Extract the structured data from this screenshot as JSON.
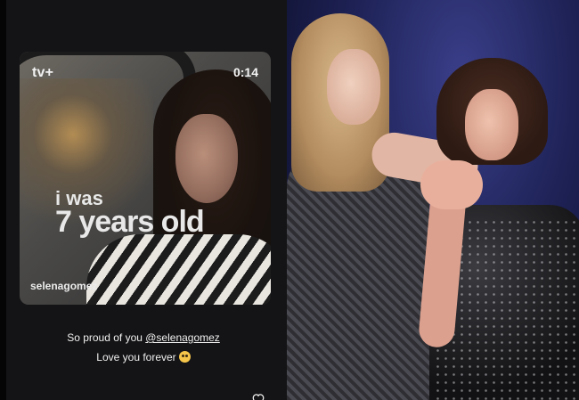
{
  "story": {
    "video": {
      "brand_label": "tv+",
      "time": "0:14",
      "caption_line1": "i was",
      "caption_line2": "7 years old",
      "watermark": "selenagomez"
    },
    "text_prefix": "So proud of you ",
    "mention": "@selenagomez",
    "text_line2": "Love you forever"
  },
  "icons": {
    "apple_logo": "apple-logo-icon",
    "emoji": "pleading-face-emoji-icon",
    "like": "heart-icon"
  },
  "colors": {
    "story_bg": "#141416",
    "photo_stage_blue": "#1e2256"
  }
}
